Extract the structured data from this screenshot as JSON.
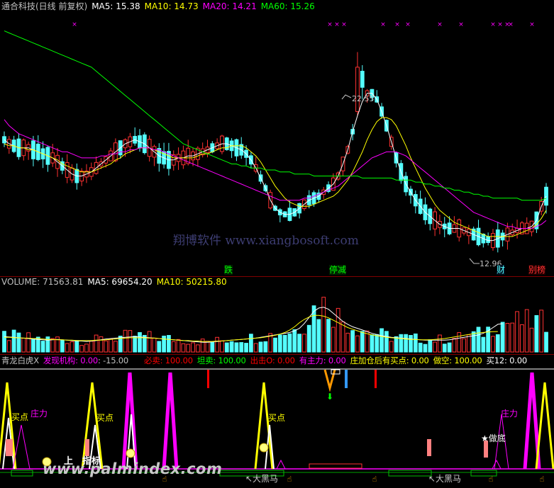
{
  "header": {
    "title": "通合科技(日线 前复权)",
    "ma5": "MA5: 15.38",
    "ma10": "MA10: 14.73",
    "ma20": "MA20: 14.21",
    "ma60": "MA60: 15.26"
  },
  "volume_header": {
    "volume": "VOLUME: 71563.81",
    "ma5": "MA5: 69654.20",
    "ma10": "MA10: 50215.80"
  },
  "indicator_header": {
    "name": "青龙白虎",
    "close_symbol": "X",
    "faxian": "发现机构: 0.00",
    "neg15": ": -15.00",
    "bimai": "必卖: 100.00",
    "tanmai": "坦卖: 100.00",
    "chuji": "出击O: 0.00",
    "youzhuli": "有主力: 0.00",
    "zhuangjia": "庄加仓后有买点: 0.00",
    "zuokong": "做空: 100.00",
    "mai12": "买12: 0.00"
  },
  "colors": {
    "up": "#ff3232",
    "down": "#54ffff",
    "ma5": "#ffffff",
    "ma10": "#ffff00",
    "ma20": "#ff00ff",
    "ma60": "#00ff00",
    "indicator_label": "#ff00ff",
    "watermark": "#3a3a6a"
  },
  "annotations": {
    "price_high": "22.55",
    "price_low": "12.96",
    "die": "跌",
    "tingjian": "停减",
    "cai": "财",
    "biebang": "别榜",
    "maidian1": "买点",
    "zhuli1": "庄力",
    "maidian2": "买点",
    "maidian3": "买点",
    "zuodi": "★做底",
    "zhuli2": "庄力",
    "shang": "上",
    "zhibiao": "指标",
    "dahei1": "↖大黑马",
    "dahei2": "↖大黑马"
  },
  "watermark": {
    "main": "翔博软件 www.xiangbosoft.com",
    "footer": "www.palmindex.com"
  },
  "chart_data": [
    {
      "type": "candlestick",
      "title": "通合科技(日线 前复权)",
      "ylim": [
        11.5,
        24.5
      ],
      "series": [
        {
          "name": "MA5",
          "values": [
            18.2,
            18.0,
            17.9,
            17.8,
            17.8,
            17.8,
            17.7,
            17.6,
            17.5,
            17.4,
            17.3,
            17.1,
            16.9,
            16.7,
            16.5,
            16.4,
            16.4,
            16.5,
            16.6,
            16.8,
            17.0,
            17.2,
            17.4,
            17.6,
            17.8,
            18.0,
            18.1,
            18.2,
            18.1,
            18.0,
            17.8,
            17.6,
            17.4,
            17.3,
            17.2,
            17.2,
            17.3,
            17.3,
            17.4,
            17.4,
            17.5,
            17.6,
            17.7,
            17.8,
            17.9,
            18.0,
            18.0,
            17.9,
            17.8,
            17.7,
            17.5,
            17.2,
            16.8,
            16.3,
            15.8,
            15.2,
            14.8,
            14.6,
            14.5,
            14.5,
            14.6,
            14.8,
            15.0,
            15.2,
            15.3,
            15.4,
            15.6,
            15.8,
            16.0,
            16.4,
            17.0,
            17.7,
            18.6,
            19.4,
            20.1,
            20.5,
            20.5,
            20.2,
            19.6,
            18.9,
            18.1,
            17.3,
            16.6,
            16.0,
            15.6,
            15.2,
            14.9,
            14.6,
            14.4,
            14.2,
            14.0,
            13.9,
            13.8,
            13.8,
            13.8,
            13.7,
            13.6,
            13.5,
            13.4,
            13.3,
            13.2,
            13.2,
            13.3,
            13.4,
            13.5,
            13.6,
            13.7,
            13.8,
            13.8,
            13.9,
            14.2,
            14.9,
            15.4
          ]
        },
        {
          "name": "MA10",
          "values": [
            18.0,
            17.9,
            17.9,
            17.8,
            17.8,
            17.7,
            17.7,
            17.6,
            17.5,
            17.4,
            17.3,
            17.2,
            17.0,
            16.9,
            16.8,
            16.7,
            16.6,
            16.6,
            16.6,
            16.7,
            16.8,
            16.9,
            17.0,
            17.2,
            17.3,
            17.5,
            17.6,
            17.7,
            17.8,
            17.8,
            17.8,
            17.7,
            17.6,
            17.5,
            17.4,
            17.3,
            17.3,
            17.3,
            17.3,
            17.3,
            17.4,
            17.5,
            17.5,
            17.6,
            17.7,
            17.8,
            17.8,
            17.9,
            17.9,
            17.9,
            17.8,
            17.6,
            17.4,
            17.1,
            16.7,
            16.3,
            15.9,
            15.6,
            15.3,
            15.1,
            15.0,
            14.9,
            14.9,
            14.9,
            15.0,
            15.1,
            15.2,
            15.3,
            15.4,
            15.6,
            15.9,
            16.2,
            16.6,
            17.1,
            17.6,
            18.2,
            18.7,
            19.1,
            19.3,
            19.3,
            19.2,
            18.9,
            18.4,
            17.9,
            17.3,
            16.8,
            16.3,
            15.8,
            15.4,
            15.0,
            14.7,
            14.5,
            14.3,
            14.1,
            14.0,
            13.9,
            13.8,
            13.7,
            13.6,
            13.5,
            13.4,
            13.4,
            13.4,
            13.4,
            13.4,
            13.4,
            13.5,
            13.6,
            13.7,
            13.8,
            14.0,
            14.3,
            14.7
          ]
        },
        {
          "name": "MA20",
          "values": [
            19.2,
            18.9,
            18.7,
            18.5,
            18.4,
            18.3,
            18.2,
            18.1,
            18.0,
            17.9,
            17.8,
            17.7,
            17.6,
            17.6,
            17.5,
            17.4,
            17.3,
            17.3,
            17.3,
            17.3,
            17.4,
            17.4,
            17.5,
            17.5,
            17.6,
            17.6,
            17.7,
            17.7,
            17.8,
            17.8,
            17.8,
            17.7,
            17.7,
            17.6,
            17.5,
            17.4,
            17.3,
            17.2,
            17.1,
            17.0,
            16.9,
            16.8,
            16.7,
            16.6,
            16.5,
            16.4,
            16.3,
            16.2,
            16.1,
            16.0,
            15.9,
            15.8,
            15.7,
            15.6,
            15.5,
            15.4,
            15.3,
            15.2,
            15.2,
            15.2,
            15.2,
            15.2,
            15.3,
            15.3,
            15.4,
            15.5,
            15.6,
            15.7,
            15.8,
            15.9,
            16.1,
            16.3,
            16.5,
            16.7,
            16.9,
            17.1,
            17.3,
            17.4,
            17.5,
            17.6,
            17.6,
            17.6,
            17.5,
            17.4,
            17.2,
            17.0,
            16.8,
            16.6,
            16.4,
            16.2,
            16.0,
            15.8,
            15.6,
            15.4,
            15.2,
            15.0,
            14.8,
            14.6,
            14.5,
            14.4,
            14.3,
            14.2,
            14.1,
            14.0,
            13.9,
            13.9,
            13.8,
            13.8,
            13.8,
            13.8,
            13.9,
            14.0,
            14.2
          ]
        },
        {
          "name": "MA60",
          "values": [
            23.6,
            23.5,
            23.4,
            23.3,
            23.2,
            23.1,
            23.0,
            22.9,
            22.8,
            22.7,
            22.6,
            22.5,
            22.4,
            22.3,
            22.2,
            22.1,
            22.0,
            21.9,
            21.8,
            21.6,
            21.4,
            21.2,
            21.0,
            20.8,
            20.6,
            20.4,
            20.2,
            20.0,
            19.8,
            19.6,
            19.4,
            19.2,
            19.0,
            18.8,
            18.6,
            18.4,
            18.2,
            18.0,
            17.9,
            17.8,
            17.7,
            17.6,
            17.5,
            17.4,
            17.3,
            17.2,
            17.1,
            17.0,
            17.0,
            16.9,
            16.9,
            16.8,
            16.8,
            16.8,
            16.7,
            16.7,
            16.7,
            16.6,
            16.6,
            16.6,
            16.5,
            16.5,
            16.5,
            16.5,
            16.4,
            16.4,
            16.4,
            16.4,
            16.4,
            16.4,
            16.4,
            16.4,
            16.4,
            16.4,
            16.3,
            16.3,
            16.3,
            16.3,
            16.3,
            16.3,
            16.3,
            16.2,
            16.2,
            16.2,
            16.2,
            16.1,
            16.1,
            16.0,
            16.0,
            15.9,
            15.9,
            15.8,
            15.8,
            15.7,
            15.7,
            15.6,
            15.6,
            15.5,
            15.5,
            15.4,
            15.4,
            15.3,
            15.3,
            15.3,
            15.3,
            15.3,
            15.3,
            15.2,
            15.2,
            15.2,
            15.2,
            15.2,
            15.3
          ]
        }
      ],
      "high": "22.55",
      "low": "12.96"
    },
    {
      "type": "bar",
      "title": "VOLUME",
      "ylim": [
        0,
        160000
      ],
      "series": [
        {
          "name": "MA5",
          "values": [
            38000,
            37000,
            36000,
            35000,
            34000,
            33000,
            32000,
            31000,
            30000,
            29000,
            30000,
            31000,
            30000,
            29000,
            28000,
            27000,
            27000,
            26000,
            27000,
            28000,
            30000,
            32000,
            33000,
            34000,
            35000,
            36000,
            37000,
            38000,
            37000,
            36000,
            35000,
            34000,
            33000,
            32000,
            31000,
            30000,
            29000,
            28000,
            27000,
            26000,
            25000,
            24000,
            24000,
            25000,
            26000,
            27000,
            28000,
            29000,
            30000,
            31000,
            32000,
            33000,
            34000,
            36000,
            38000,
            40000,
            42000,
            44000,
            46000,
            48000,
            52000,
            58000,
            70000,
            85000,
            100000,
            108000,
            110000,
            105000,
            95000,
            85000,
            75000,
            68000,
            62000,
            58000,
            54000,
            50000,
            46000,
            43000,
            40000,
            38000,
            36000,
            35000,
            34000,
            33000,
            32000,
            31000,
            30000,
            29000,
            29000,
            29000,
            29000,
            29000,
            30000,
            32000,
            34000,
            36000,
            38000,
            40000,
            42000,
            46000,
            52000,
            60000,
            68000,
            69654
          ]
        },
        {
          "name": "MA10",
          "values": [
            36000,
            36000,
            35000,
            35000,
            34000,
            34000,
            33000,
            33000,
            32000,
            31000,
            31000,
            30000,
            30000,
            29000,
            29000,
            28000,
            28000,
            28000,
            28000,
            29000,
            29000,
            30000,
            31000,
            32000,
            33000,
            34000,
            35000,
            35000,
            35000,
            35000,
            34000,
            34000,
            33000,
            32000,
            31000,
            30000,
            29000,
            28000,
            28000,
            27000,
            27000,
            26000,
            26000,
            26000,
            27000,
            27000,
            28000,
            29000,
            30000,
            31000,
            32000,
            33000,
            34000,
            35000,
            37000,
            39000,
            41000,
            44000,
            48000,
            54000,
            62000,
            72000,
            80000,
            86000,
            90000,
            90000,
            88000,
            84000,
            78000,
            72000,
            66000,
            60000,
            56000,
            52000,
            48000,
            45000,
            42000,
            40000,
            38000,
            36000,
            35000,
            34000,
            33000,
            32000,
            31000,
            31000,
            30000,
            30000,
            30000,
            31000,
            32000,
            33000,
            35000,
            37000,
            39000,
            41000,
            43000,
            45000,
            47000,
            48000,
            49000,
            50000,
            50215
          ]
        }
      ]
    }
  ]
}
